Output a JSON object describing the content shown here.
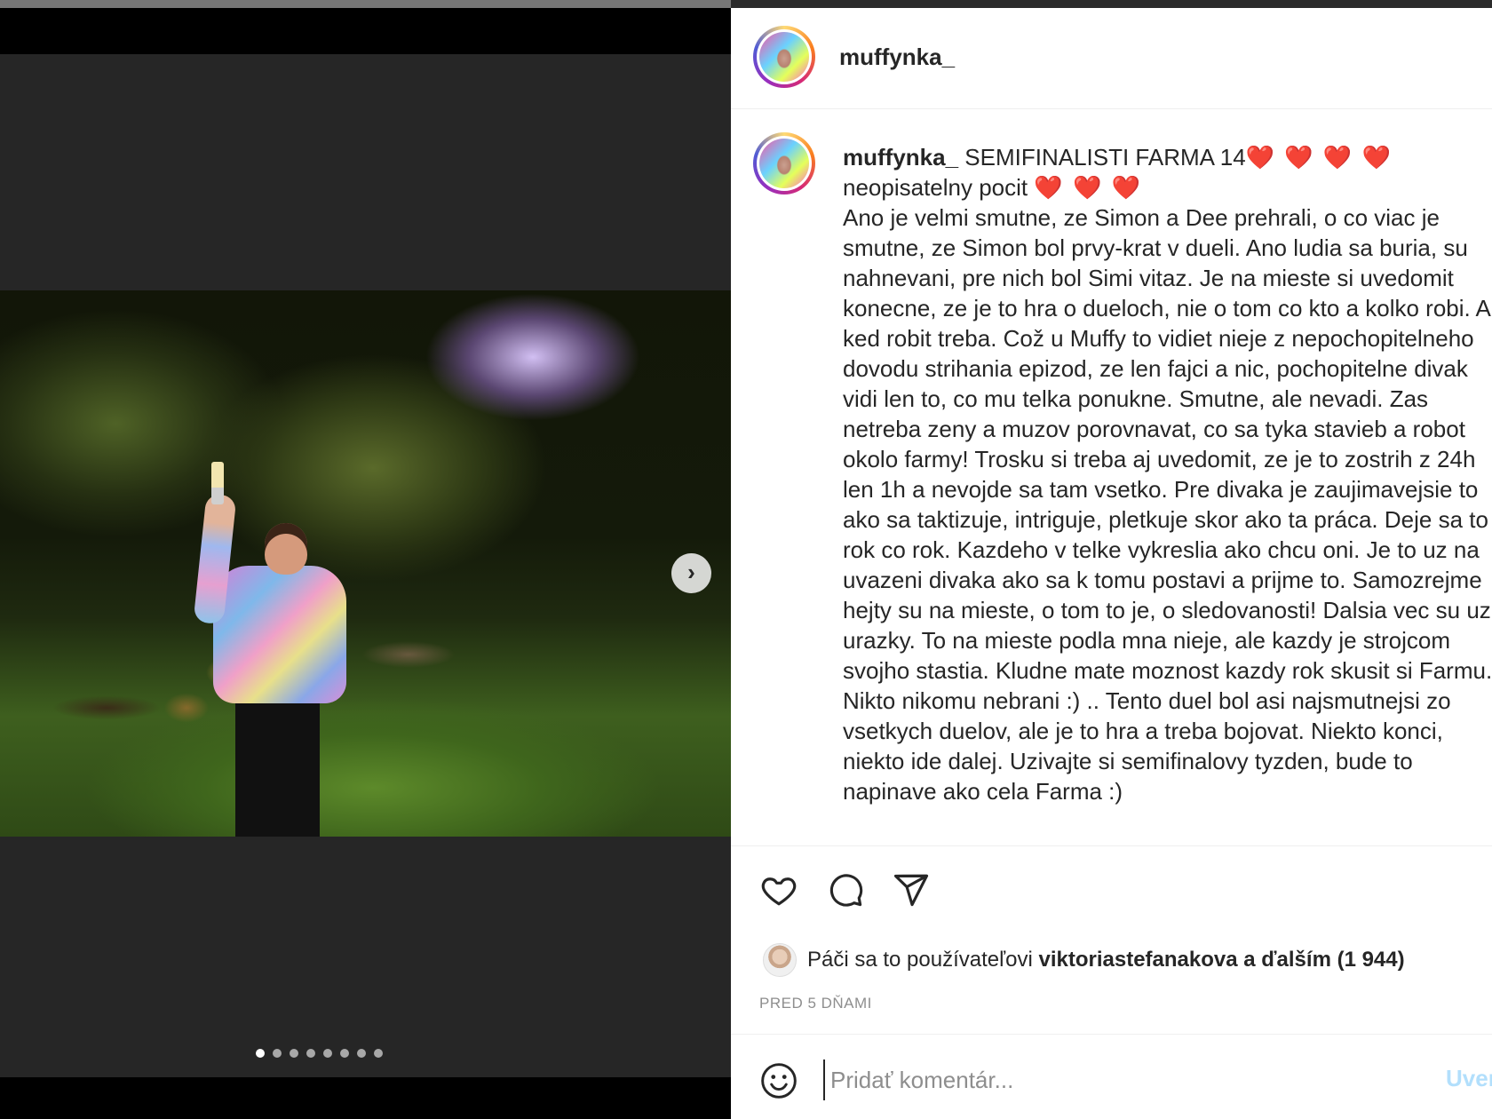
{
  "post": {
    "username": "muffynka_",
    "caption_lead": "SEMIFINALISTI FARMA 14",
    "caption_hearts_1": "❤️ ❤️ ❤️ ❤️",
    "caption_mid": "neopisatelny pocit",
    "caption_hearts_2": "❤️ ❤️ ❤️",
    "caption_body": "Ano je velmi smutne, ze Simon a Dee prehrali, o co viac je smutne, ze Simon bol prvy-krat v dueli. Ano ludia sa buria, su nahnevani, pre nich bol Simi vitaz. Je na mieste si uvedomit konecne, ze je to hra o dueloch, nie o tom co kto a kolko robi. A ked robit treba. Což u Muffy to vidiet nieje z nepochopitelneho dovodu strihania epizod, ze len fajci a nic, pochopitelne divak vidi len to, co mu telka ponukne. Smutne, ale nevadi. Zas netreba zeny a muzov porovnavat, co sa tyka stavieb a robot okolo farmy! Trosku si treba aj uvedomit, ze je to zostrih z 24h len 1h a nevojde sa tam vsetko. Pre divaka je zaujimavejsie to ako sa taktizuje, intriguje, pletkuje skor ako ta práca. Deje sa to rok co rok. Kazdeho v telke vykreslia ako chcu oni. Je to uz na uvazeni divaka ako sa k tomu postavi a prijme to. Samozrejme hejty su na mieste, o tom to je, o sledovanosti! Dalsia vec su uz urazky. To na mieste podla mna nieje, ale kazdy je strojcom svojho stastia. Kludne mate moznost kazdy rok skusit si Farmu. Nikto nikomu nebrani :) .. Tento duel bol asi najsmutnejsi zo vsetkych duelov, ale je to hra a treba bojovat. Niekto konci, niekto ide dalej. Uzivajte si semifinalovy tyzden, bude to napinave ako cela Farma :)"
  },
  "media": {
    "next_icon": "chevron-right-icon",
    "slide_count": 8,
    "active_slide": 1
  },
  "actions": {
    "like_icon": "heart-icon",
    "comment_icon": "comment-icon",
    "share_icon": "paper-plane-icon"
  },
  "likes": {
    "prefix": "Páči sa to používateľovi",
    "user": "viktoriastefanakova",
    "suffix": "a ďalším (1 944)"
  },
  "timestamp": "PRED 5 DŇAMI",
  "comment": {
    "placeholder": "Pridať komentár...",
    "post_label": "Uverejniť",
    "emoji_icon": "smiley-icon"
  }
}
